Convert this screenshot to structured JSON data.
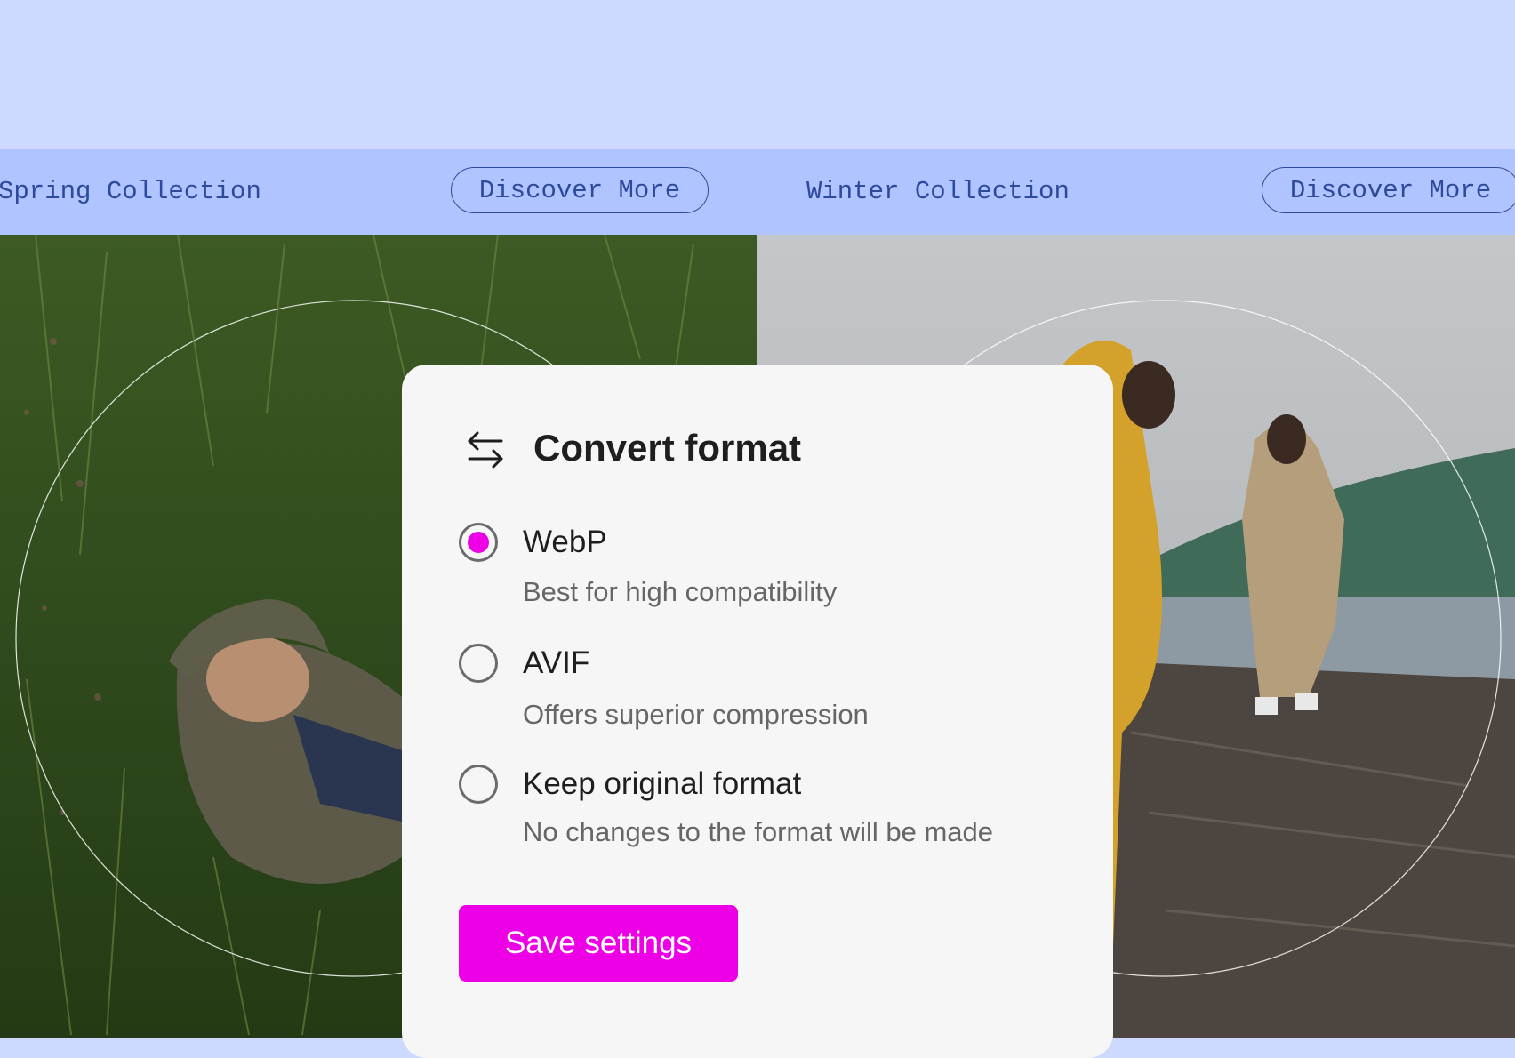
{
  "collections": [
    {
      "label": "Spring Collection",
      "button": "Discover More"
    },
    {
      "label": "Winter Collection",
      "button": "Discover More"
    }
  ],
  "dialog": {
    "icon": "swap-arrows-icon",
    "title": "Convert format",
    "options": [
      {
        "label": "WebP",
        "description": "Best for high compatibility",
        "selected": true
      },
      {
        "label": "AVIF",
        "description": "Offers superior compression",
        "selected": false
      },
      {
        "label": "Keep original format",
        "description": "No changes to the format will be made",
        "selected": false
      }
    ],
    "save_label": "Save settings"
  },
  "colors": {
    "accent": "#ee00e6",
    "band": "#cdd9ff",
    "bar": "#b0c4ff",
    "bar_text": "#2e4a9c"
  }
}
